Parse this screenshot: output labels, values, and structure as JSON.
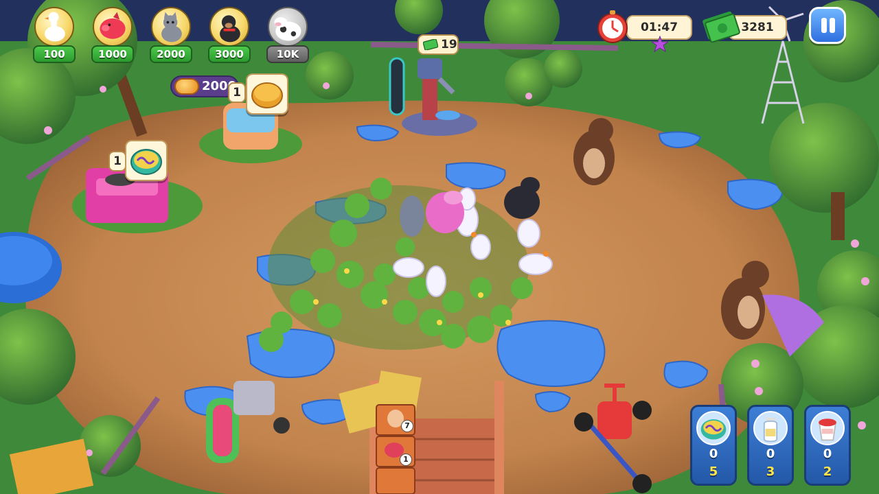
{
  "shop": [
    {
      "animal": "goose",
      "icon": "goose-icon",
      "price": "100",
      "locked": false
    },
    {
      "animal": "pig",
      "icon": "pig-icon",
      "price": "1000",
      "locked": false
    },
    {
      "animal": "cat",
      "icon": "cat-icon",
      "price": "2000",
      "locked": false
    },
    {
      "animal": "dog",
      "icon": "dog-icon",
      "price": "3000",
      "locked": false
    },
    {
      "animal": "cow",
      "icon": "cow-icon",
      "price": "10K",
      "locked": true
    }
  ],
  "timer": {
    "value": "01:47",
    "icon": "stopwatch-icon"
  },
  "money": {
    "value": "3281",
    "icon": "cash-icon"
  },
  "pause": {
    "icon": "pause-icon"
  },
  "well": {
    "cost": "19",
    "icon": "cash-icon"
  },
  "bakery": {
    "coins": "2000",
    "queue": "1",
    "icon": "cookie-icon"
  },
  "machine": {
    "queue": "1",
    "icon": "noodle-icon"
  },
  "crate": {
    "egg_count": "7",
    "meat_count": "1"
  },
  "inventory": [
    {
      "name": "noodles",
      "icon": "noodle-icon",
      "have": "0",
      "goal": "5"
    },
    {
      "name": "milk",
      "icon": "milk-bottle-icon",
      "have": "0",
      "goal": "3"
    },
    {
      "name": "yogurt",
      "icon": "yogurt-icon",
      "have": "0",
      "goal": "2"
    }
  ],
  "colors": {
    "grass": "#3e8a3a",
    "dirt": "#c98a52",
    "water": "#3f7ee8",
    "hud_green": "#2c9a2e",
    "hud_blue": "#2f6fe0",
    "goal_yellow": "#ffe54a"
  }
}
